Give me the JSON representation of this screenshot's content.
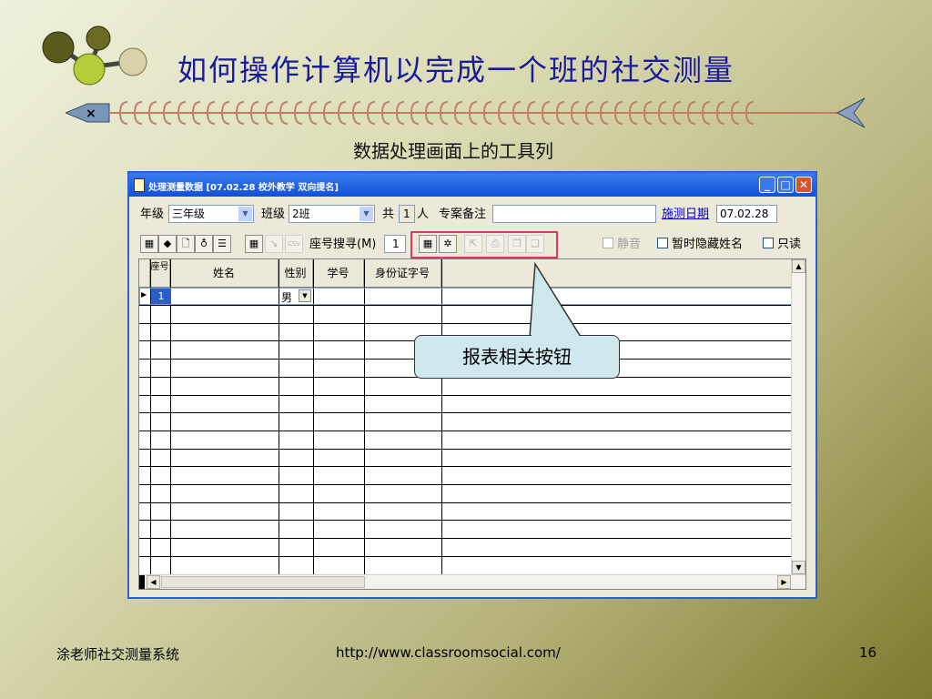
{
  "slide": {
    "title": "如何操作计算机以完成一个班的社交测量",
    "subtitle": "数据处理画面上的工具列",
    "callout": "报表相关按钮",
    "footer_left": "涂老师社交测量系统",
    "footer_url": "http://www.classroomsocial.com/",
    "page_number": "16"
  },
  "window": {
    "title": "处理测量数据 [07.02.28  校外教学  双向提名]",
    "grade_label": "年级",
    "grade_value": "三年级",
    "class_label": "班级",
    "class_value": "2班",
    "total_label": "共",
    "total_value": "1",
    "person_label": "人",
    "note_label": "专案备注",
    "note_value": "",
    "date_link": "施测日期",
    "date_value": "07.02.28",
    "seat_search_label": "座号搜寻(M)",
    "seat_search_value": "1",
    "mute_label": "静音",
    "hide_names_label": "暂时隐藏姓名",
    "readonly_label": "只读",
    "csv_label": "CSV"
  },
  "grid": {
    "headers": [
      "座号",
      "姓名",
      "性别",
      "学号",
      "身份证字号"
    ],
    "rows": [
      {
        "seat": "1",
        "name": "",
        "gender": "男",
        "student_no": "",
        "id_no": ""
      }
    ]
  },
  "colors": {
    "title": "#1a1a9c",
    "titlebar": "#1050d8",
    "highlight_box": "#e0356a",
    "callout_fill": "#cfe8ee"
  }
}
